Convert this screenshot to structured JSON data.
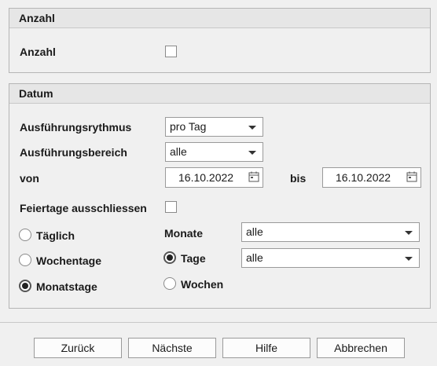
{
  "anzahl_group": {
    "title": "Anzahl",
    "anzahl_label": "Anzahl",
    "anzahl_checked": false
  },
  "datum_group": {
    "title": "Datum",
    "rhythmus_label": "Ausführungsrythmus",
    "rhythmus_value": "pro Tag",
    "bereich_label": "Ausführungsbereich",
    "bereich_value": "alle",
    "von_label": "von",
    "von_value": "16.10.2022",
    "bis_label": "bis",
    "bis_value": "16.10.2022",
    "feiertage_label": "Feiertage ausschliessen",
    "feiertage_checked": false,
    "frequency_options": [
      {
        "label": "Täglich",
        "selected": false
      },
      {
        "label": "Wochentage",
        "selected": false
      },
      {
        "label": "Monatstage",
        "selected": true
      }
    ],
    "monate_label": "Monate",
    "monate_value": "alle",
    "tage_label": "Tage",
    "tage_value": "alle",
    "tage_selected": true,
    "wochen_label": "Wochen",
    "wochen_selected": false
  },
  "footer": {
    "back_label": "Zurück",
    "next_label": "Nächste",
    "help_label": "Hilfe",
    "cancel_label": "Abbrechen"
  }
}
